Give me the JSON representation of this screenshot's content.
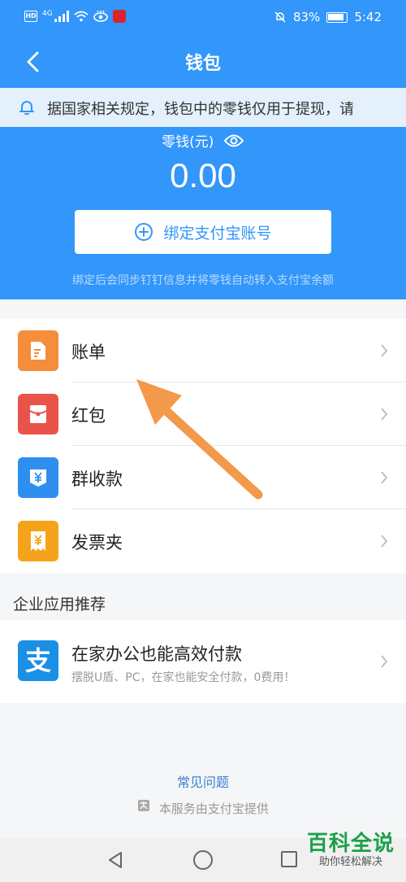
{
  "status_bar": {
    "network": "4G",
    "battery": "83%",
    "time": "5:42"
  },
  "nav": {
    "title": "钱包"
  },
  "notice": {
    "text": "据国家相关规定，钱包中的零钱仅用于提现，请"
  },
  "balance": {
    "label": "零钱(元)",
    "amount": "0.00"
  },
  "bind": {
    "button_label": "绑定支付宝账号",
    "hint": "绑定后会同步钉钉信息并将零钱自动转入支付宝余额"
  },
  "menu": {
    "items": [
      {
        "label": "账单",
        "icon": "bill-icon",
        "color": "#f58d3b"
      },
      {
        "label": "红包",
        "icon": "red-envelope-icon",
        "color": "#e9544a"
      },
      {
        "label": "群收款",
        "icon": "group-payment-icon",
        "color": "#2e8ff0"
      },
      {
        "label": "发票夹",
        "icon": "invoice-icon",
        "color": "#f5a31a"
      }
    ]
  },
  "section": {
    "title": "企业应用推荐"
  },
  "promo": {
    "title": "在家办公也能高效付款",
    "description": "摆脱U盾、PC，在家也能安全付款，0费用！",
    "icon": "alipay-icon",
    "icon_glyph": "支"
  },
  "footer": {
    "faq": "常见问题",
    "provider": "本服务由支付宝提供"
  },
  "watermark": {
    "main": "百科全说",
    "sub": "助你轻松解决"
  },
  "colors": {
    "primary": "#3296fa",
    "notice_bg": "#e4f1fd",
    "arrow": "#f2994a"
  }
}
